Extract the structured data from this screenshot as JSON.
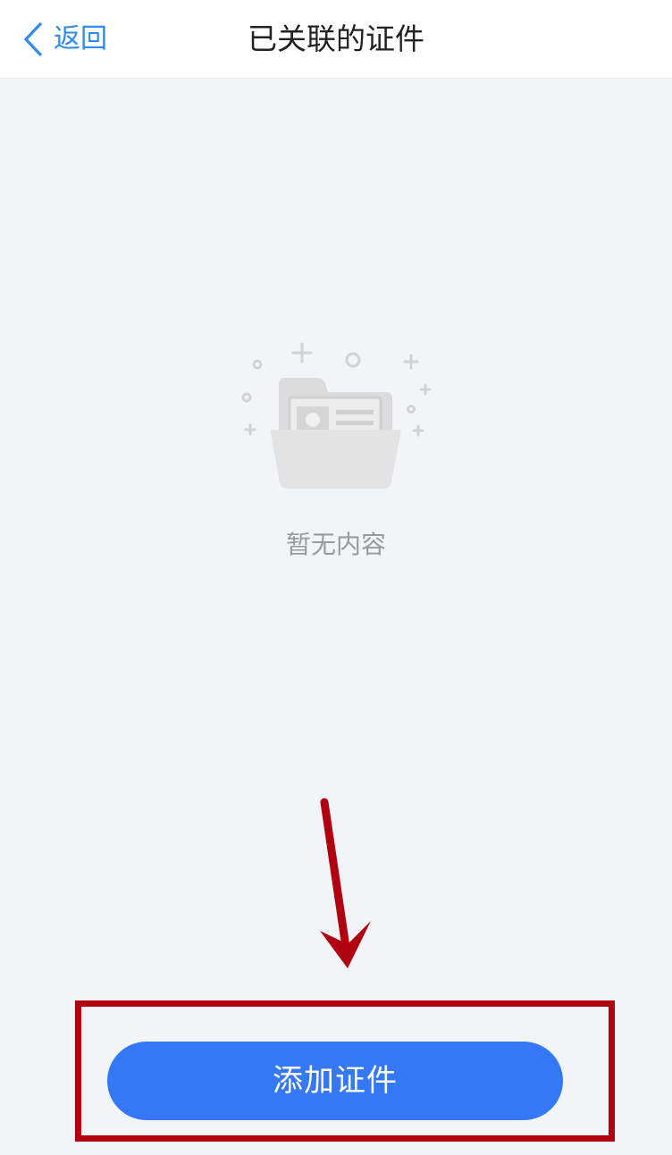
{
  "navbar": {
    "back_label": "返回",
    "title": "已关联的证件",
    "back_icon": "chevron-left-icon"
  },
  "empty_state": {
    "icon": "empty-folder-icon",
    "message": "暂无内容"
  },
  "actions": {
    "add_label": "添加证件"
  },
  "annotation": {
    "arrow_icon": "arrow-down-icon",
    "arrow_color": "#b1000f",
    "box_color": "#b1000f"
  },
  "colors": {
    "accent": "#2f8bea",
    "button": "#3478f6",
    "background": "#f2f5f8"
  }
}
